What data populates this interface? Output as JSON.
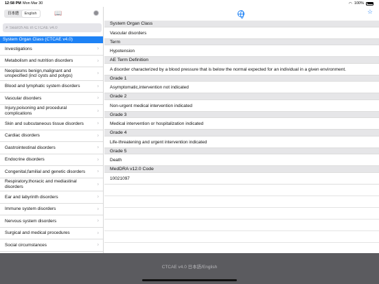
{
  "status": {
    "time": "12:58 PM",
    "date": "Mon Mar 30",
    "battery": "100%"
  },
  "sidebar": {
    "lang_ja": "日本語",
    "lang_en": "English",
    "search_placeholder": "Search AE in CTCAE v4.0",
    "section_title": "System Organ Class (CTCAE v4.0)",
    "items": [
      "Investigations",
      "Metabolism and nutrition disorders",
      "Neoplasms benign,malignant and unspecified (incl cysts and polyps)",
      "Blood and lymphatic system disorders",
      "Vascular disorders",
      "Injury,poisoning and procedural complications",
      "Skin and subcutaneous tissue disorders",
      "Cardiac disorders",
      "Gastrointestinal disorders",
      "Endocrine disorders",
      "Congenital,familial and genetic disorders",
      "Respiratory,thoracic and mediastinal disorders",
      "Ear and labyrinth disorders",
      "Immune system disorders",
      "Nervous system disorders",
      "Surgical and medical procedures",
      "Social circumstances"
    ]
  },
  "detail": {
    "rows": [
      {
        "label": "System Organ Class",
        "value": "Vascular disorders"
      },
      {
        "label": "Term",
        "value": "Hypotension"
      },
      {
        "label": "AE Term Definition",
        "value": "A disorder characterized by a blood pressure that is below the normal expected for an individual in a given environment."
      },
      {
        "label": "Grade 1",
        "value": "Asymptomatic,intervention not indicated"
      },
      {
        "label": "Grade 2",
        "value": "Non-urgent medical intervention indicated"
      },
      {
        "label": "Grade 3",
        "value": "Medical intervention or hospitalization indicated"
      },
      {
        "label": "Grade 4",
        "value": "Life-threatening and urgent intervention indicated"
      },
      {
        "label": "Grade 5",
        "value": "Death"
      },
      {
        "label": "MedDRA v12.0 Code",
        "value": "10021097"
      }
    ]
  },
  "footer": {
    "text": "CTCAE v4.0 日本語/English"
  },
  "colors": {
    "accent": "#1e82f5",
    "footer": "#5b5b5f",
    "header_row": "#e6e6e8"
  }
}
